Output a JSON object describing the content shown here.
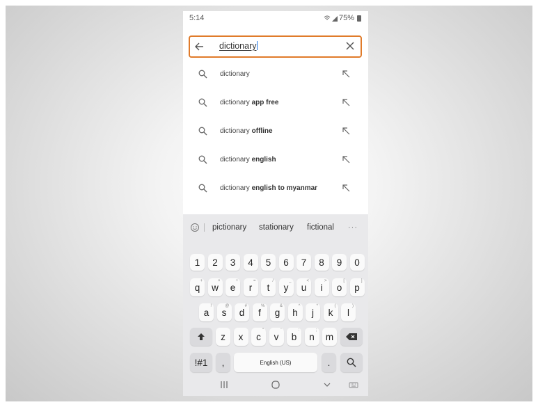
{
  "status": {
    "time": "5:14",
    "battery": "75%"
  },
  "search": {
    "query": "dictionary"
  },
  "suggestions": [
    {
      "prefix": "dictionary",
      "suffix": ""
    },
    {
      "prefix": "dictionary",
      "suffix": " app free"
    },
    {
      "prefix": "dictionary",
      "suffix": " offline"
    },
    {
      "prefix": "dictionary",
      "suffix": " english"
    },
    {
      "prefix": "dictionary",
      "suffix": " english to myanmar"
    }
  ],
  "predictions": [
    "pictionary",
    "stationary",
    "fictional"
  ],
  "keyboard": {
    "numbers": [
      "1",
      "2",
      "3",
      "4",
      "5",
      "6",
      "7",
      "8",
      "9",
      "0"
    ],
    "row1": [
      "q",
      "w",
      "e",
      "r",
      "t",
      "y",
      "u",
      "i",
      "o",
      "p"
    ],
    "row1_hints": [
      "+",
      "×",
      "÷",
      "=",
      "/",
      "_",
      "<",
      ">",
      "[",
      "]"
    ],
    "row2": [
      "a",
      "s",
      "d",
      "f",
      "g",
      "h",
      "j",
      "k",
      "l"
    ],
    "row2_hints": [
      "!",
      "@",
      "#",
      "%",
      "&",
      "^",
      "*",
      "(",
      ")"
    ],
    "row3": [
      "z",
      "x",
      "c",
      "v",
      "b",
      "n",
      "m"
    ],
    "row3_hints": [
      "",
      "",
      "\"",
      "'",
      ":",
      ";",
      ""
    ],
    "symbols_label": "!#1",
    "comma_label": ",",
    "space_label": "English (US)",
    "period_label": "."
  },
  "colors": {
    "highlight": "#e07b2a",
    "cursor": "#1a73e8"
  }
}
